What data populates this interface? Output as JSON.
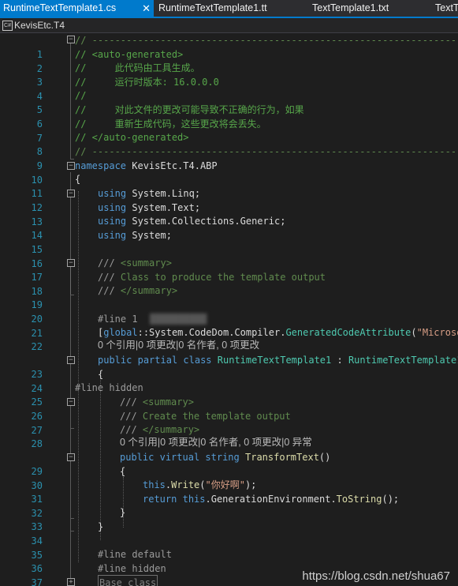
{
  "tabs": [
    {
      "label": "RuntimeTextTemplate1.cs",
      "active": true,
      "close": "✕"
    },
    {
      "label": "RuntimeTextTemplate1.tt",
      "active": false
    },
    {
      "label": "TextTemplate1.txt",
      "active": false
    },
    {
      "label": "TextT",
      "active": false
    }
  ],
  "navbar": {
    "icon": "C#",
    "file": "KevisEtc.T4"
  },
  "colors": {
    "accent": "#007acc",
    "keyword": "#569cd6",
    "comment": "#57a64a",
    "type": "#4ec9b0",
    "string": "#d69d85",
    "line_number": "#2b91af"
  },
  "code": {
    "lines": {
      "l1": {
        "num": "1",
        "p1": "// ----------------------------------------------------------------------"
      },
      "l2": {
        "num": "2",
        "p1": "// <auto-generated>"
      },
      "l3": {
        "num": "3",
        "p1": "//     此代码由工具生成。"
      },
      "l4": {
        "num": "4",
        "p1": "//     运行时版本: 16.0.0.0"
      },
      "l5": {
        "num": "5",
        "p1": "//"
      },
      "l6": {
        "num": "6",
        "p1": "//     对此文件的更改可能导致不正确的行为，如果"
      },
      "l7": {
        "num": "7",
        "p1": "//     重新生成代码，这些更改将会丢失。"
      },
      "l8": {
        "num": "8",
        "p1": "// </auto-generated>"
      },
      "l9": {
        "num": "9",
        "p1": "// ----------------------------------------------------------------------"
      },
      "l10": {
        "num": "10",
        "kw": "namespace",
        "name": " KevisEtc.T4.ABP"
      },
      "l11": {
        "num": "11",
        "p1": "{"
      },
      "l12": {
        "num": "12",
        "kw": "using",
        "name": " System.Linq;"
      },
      "l13": {
        "num": "13",
        "kw": "using",
        "name": " System.Text;"
      },
      "l14": {
        "num": "14",
        "kw": "using",
        "name": " System.Collections.Generic;"
      },
      "l15": {
        "num": "15",
        "kw": "using",
        "name": " System;"
      },
      "l16": {
        "num": "16"
      },
      "l17": {
        "num": "17",
        "a": "/// ",
        "b": "<summary>"
      },
      "l18": {
        "num": "18",
        "a": "/// ",
        "b": "Class to produce the template output"
      },
      "l19": {
        "num": "19",
        "a": "/// ",
        "b": "</summary>"
      },
      "l20": {
        "num": "20"
      },
      "l21": {
        "num": "21",
        "p1": "#line 1"
      },
      "l22": {
        "num": "22",
        "a": "[",
        "b": "global",
        "c": "::System.CodeDom.Compiler.",
        "d": "GeneratedCodeAttribute",
        "e": "(",
        "f": "\"Microso"
      },
      "lens1": "0 个引用|0 项更改|0 名作者, 0 项更改",
      "l23": {
        "num": "23",
        "a": "public",
        "b": " ",
        "c": "partial",
        "d": " ",
        "e": "class",
        "f": " ",
        "g": "RuntimeTextTemplate1",
        "h": " : ",
        "i": "RuntimeTextTemplate1"
      },
      "l24": {
        "num": "24",
        "p1": "{"
      },
      "l25": {
        "num": "25",
        "p1": "#line hidden"
      },
      "l26": {
        "num": "26",
        "a": "/// ",
        "b": "<summary>"
      },
      "l27": {
        "num": "27",
        "a": "/// ",
        "b": "Create the template output"
      },
      "l28": {
        "num": "28",
        "a": "/// ",
        "b": "</summary>"
      },
      "lens2": "0 个引用|0 项更改|0 名作者, 0 项更改|0 异常",
      "l29": {
        "num": "29",
        "a": "public",
        "b": " ",
        "c": "virtual",
        "d": " ",
        "e": "string",
        "f": " ",
        "g": "TransformText",
        "h": "()"
      },
      "l30": {
        "num": "30",
        "p1": "{"
      },
      "l31": {
        "num": "31",
        "a": "this",
        "b": ".",
        "c": "Write",
        "d": "(",
        "e": "\"你好啊\"",
        "f": ");"
      },
      "l32": {
        "num": "32",
        "a": "return",
        "b": " ",
        "c": "this",
        "d": ".GenerationEnvironment.",
        "e": "ToString",
        "f": "();"
      },
      "l33": {
        "num": "33",
        "p1": "}"
      },
      "l34": {
        "num": "34",
        "p1": "}"
      },
      "l35": {
        "num": "35"
      },
      "l36": {
        "num": "36",
        "p1": "#line default"
      },
      "l37": {
        "num": "37",
        "p1": "#line hidden"
      },
      "l38": {
        "num": "38",
        "p1": "Base class"
      }
    }
  },
  "watermark": "https://blog.csdn.net/shua67"
}
